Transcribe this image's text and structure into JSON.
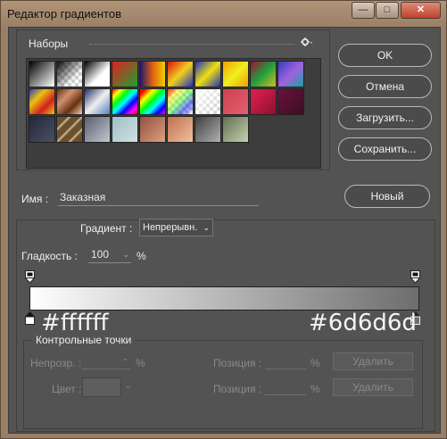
{
  "window": {
    "title": "Редактор градиентов",
    "controls": {
      "minimize": "—",
      "maximize": "□",
      "close": "✕"
    }
  },
  "presets": {
    "title": "Наборы",
    "menu_icon": "gear-icon"
  },
  "buttons": {
    "ok": "OK",
    "cancel": "Отмена",
    "load": "Загрузить...",
    "save": "Сохранить...",
    "new": "Новый"
  },
  "name_field": {
    "label": "Имя :",
    "value": "Заказная"
  },
  "gradient": {
    "type_label": "Градиент :",
    "type_value": "Непрерывн.",
    "smoothness_label": "Гладкость :",
    "smoothness_value": "100",
    "smoothness_unit": "%",
    "start_color": "#ffffff",
    "end_color": "#6d6d6d",
    "start_color_label": "#ffffff",
    "end_color_label": "#6d6d6d"
  },
  "stops": {
    "title": "Контрольные точки",
    "opacity_label": "Непрозр. :",
    "opacity_unit": "%",
    "position_label_1": "Позиция :",
    "position_unit_1": "%",
    "delete_1": "Удалить",
    "color_label": "Цвет :",
    "position_label_2": "Позиция :",
    "position_unit_2": "%",
    "delete_2": "Удалить"
  },
  "swatches": [
    "linear-gradient(135deg,#000,#fff)",
    "checker-black",
    "linear-gradient(135deg,#000,#fff 60%,#fff)",
    "linear-gradient(135deg,#e02020,#20a030)",
    "linear-gradient(90deg,#201870,#e06010,#f0d000)",
    "linear-gradient(135deg,#e01010,#f0d020,#2030c0)",
    "linear-gradient(135deg,#2030c0,#f0e010,#2030c0)",
    "linear-gradient(135deg,#f0a000,#f0f020,#f0a000)",
    "linear-gradient(135deg,#a01030,#20a040,#d0c020)",
    "linear-gradient(135deg,#3040c0,#a060e0,#20a0a0)",
    "linear-gradient(135deg,#2040c0,#f0c010,#d02020,#f0c010)",
    "linear-gradient(135deg,#6a3010,#d09070,#6a3010,#f0d0c0)",
    "linear-gradient(135deg,#20306a,#f0f0f0,#5080c0)",
    "linear-gradient(135deg,#f00,#ff0,#0f0,#0ff,#00f,#f0f,#f00)",
    "linear-gradient(135deg,#f00 10%,#ff0,#0f0,#0ff,#00f,#f0f)",
    "checker-rainbow",
    "checker-white",
    "linear-gradient(135deg,#d04050,#e06070)",
    "linear-gradient(135deg,#e02050,#901030)",
    "linear-gradient(135deg,#6a1040,#3a1020)",
    "linear-gradient(135deg,#20283a,#4a5060)",
    "linear-gradient(135deg,#6a5030 20%,#d0c090 25%,#6a5030 30%,#6a5030 45%,#d0c090 50%,#6a5030 55%,#6a5030 70%,#d0c090 75%,#6a5030 80%)",
    "linear-gradient(135deg,#5a6070,#c0c8d0)",
    "linear-gradient(135deg,#a0c0c8,#d0e0e0)",
    "linear-gradient(135deg,#905040,#e0a080)",
    "linear-gradient(135deg,#c07050,#f0c0a0)",
    "linear-gradient(135deg,#404040,#b0b0b0)",
    "linear-gradient(135deg,#607050,#c8d0b0)"
  ]
}
